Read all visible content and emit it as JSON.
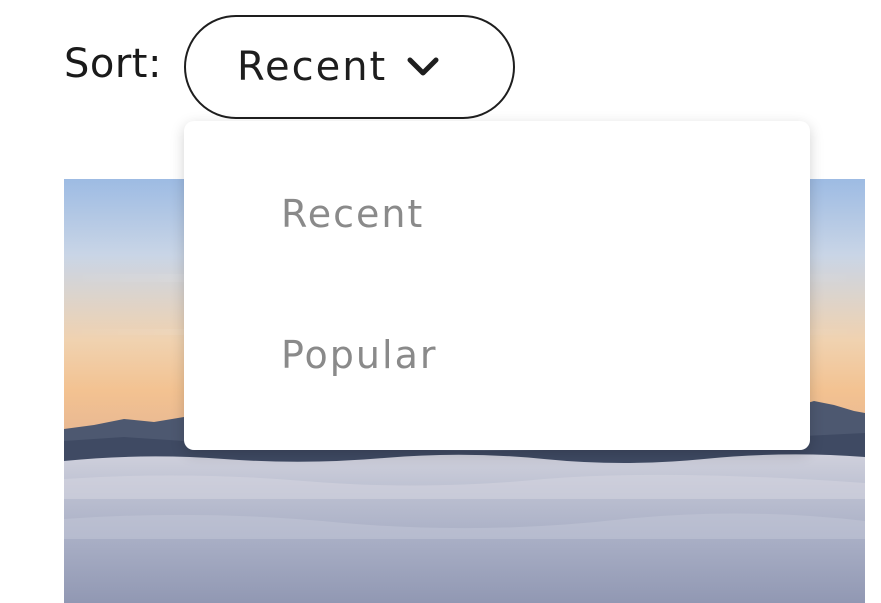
{
  "sort": {
    "label": "Sort:",
    "selected": "Recent",
    "options": [
      {
        "label": "Recent"
      },
      {
        "label": "Popular"
      }
    ]
  },
  "icons": {
    "trigger_icon": "chevron-down-icon"
  },
  "colors": {
    "text_primary": "#1e1e1e",
    "menu_text": "#8a8a8a",
    "background": "#ffffff"
  }
}
